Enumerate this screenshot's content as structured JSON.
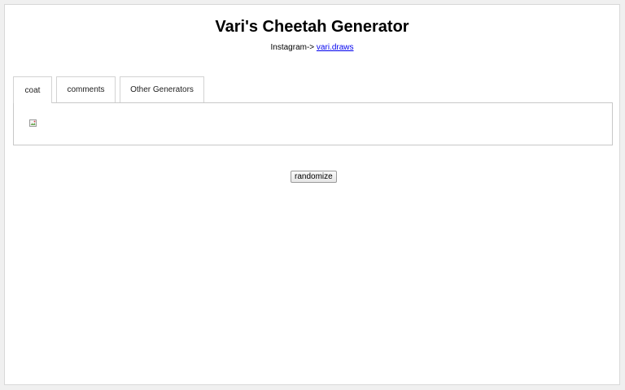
{
  "header": {
    "title": "Vari's Cheetah Generator",
    "instagram_prefix": "Instagram-> ",
    "instagram_link": "vari.draws"
  },
  "tabs": [
    {
      "label": "coat",
      "active": true
    },
    {
      "label": "comments",
      "active": false
    },
    {
      "label": "Other Generators",
      "active": false
    }
  ],
  "panel": {
    "image_icon": "broken-image-icon"
  },
  "actions": {
    "randomize_label": "randomize"
  },
  "colors": {
    "link": "#0000ee",
    "border": "#d3d3d3"
  }
}
